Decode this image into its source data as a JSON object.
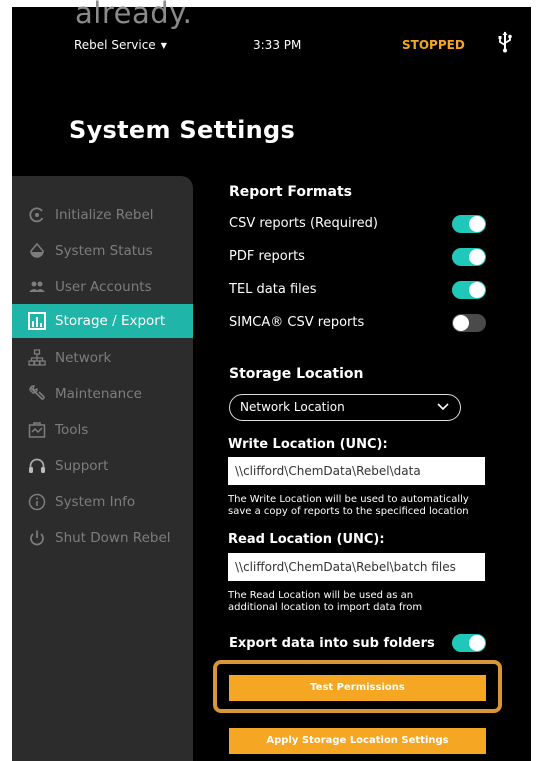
{
  "overlay_text": "already.",
  "status_bar": {
    "service_menu": "Rebel Service",
    "time": "3:33 PM",
    "state": "STOPPED",
    "state_color": "#f5a623"
  },
  "page_title": "System Settings",
  "sidebar": {
    "items": [
      {
        "label": "Initialize Rebel",
        "icon": "initialize-icon"
      },
      {
        "label": "System Status",
        "icon": "status-drop-icon"
      },
      {
        "label": "User Accounts",
        "icon": "users-icon"
      },
      {
        "label": "Storage / Export",
        "icon": "storage-chart-icon",
        "active": true
      },
      {
        "label": "Network",
        "icon": "network-icon"
      },
      {
        "label": "Maintenance",
        "icon": "wrench-icon"
      },
      {
        "label": "Tools",
        "icon": "tools-icon"
      },
      {
        "label": "Support",
        "icon": "headset-icon"
      },
      {
        "label": "System Info",
        "icon": "info-icon"
      },
      {
        "label": "Shut Down Rebel",
        "icon": "power-icon"
      }
    ],
    "active_color": "#1fb5a8"
  },
  "report_formats": {
    "title": "Report Formats",
    "rows": [
      {
        "label": "CSV reports (Required)",
        "on": true
      },
      {
        "label": "PDF reports",
        "on": true
      },
      {
        "label": "TEL data files",
        "on": true
      },
      {
        "label": "SIMCA® CSV reports",
        "on": false
      }
    ]
  },
  "storage_location": {
    "title": "Storage Location",
    "selected": "Network Location",
    "write_label": "Write Location (UNC):",
    "write_value": "\\\\clifford\\ChemData\\Rebel\\data",
    "write_hint_1": "The Write Location will be used to automatically",
    "write_hint_2": "save a copy of reports to the specificed location",
    "read_label": "Read Location (UNC):",
    "read_value": "\\\\clifford\\ChemData\\Rebel\\batch files",
    "read_hint_1": "The Read Location will be used as an",
    "read_hint_2": "additional location to import data from",
    "export_subfolders_label": "Export data into sub folders",
    "export_subfolders_on": true
  },
  "buttons": {
    "test_permissions": "Test Permissions",
    "apply_settings": "Apply Storage Location Settings"
  },
  "colors": {
    "accent": "#1fc8b8",
    "button": "#f5a623",
    "highlight": "#d8953a"
  }
}
